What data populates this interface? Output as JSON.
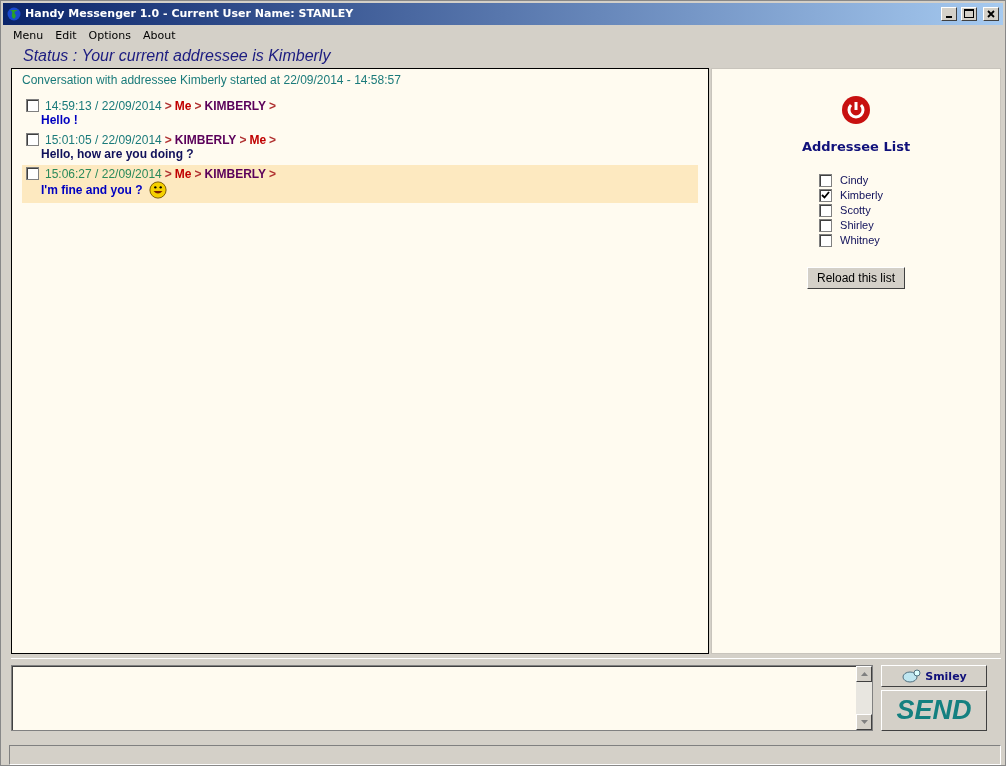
{
  "window": {
    "title": "Handy Messenger 1.0 - Current User Name: STANLEY"
  },
  "menu": [
    "Menu",
    "Edit",
    "Options",
    "About"
  ],
  "status": "Status : Your current addressee is Kimberly",
  "conversation": {
    "header": "Conversation with addressee Kimberly started at 22/09/2014 - 14:58:57",
    "separator": ">",
    "messages": [
      {
        "time": "14:59:13 / 22/09/2014",
        "from": "Me",
        "to": "KIMBERLY",
        "text": "Hello !",
        "kind": "outgoing",
        "checked": false,
        "selected": false,
        "smiley": false
      },
      {
        "time": "15:01:05 / 22/09/2014",
        "from": "KIMBERLY",
        "to": "Me",
        "text": "Hello, how are you doing ?",
        "kind": "incoming",
        "checked": false,
        "selected": false,
        "smiley": false
      },
      {
        "time": "15:06:27 / 22/09/2014",
        "from": "Me",
        "to": "KIMBERLY",
        "text": "I'm fine and you ?",
        "kind": "outgoing",
        "checked": false,
        "selected": true,
        "smiley": true
      }
    ]
  },
  "addressees": {
    "title": "Addressee List",
    "items": [
      {
        "name": "Cindy",
        "checked": false
      },
      {
        "name": "Kimberly",
        "checked": true
      },
      {
        "name": "Scotty",
        "checked": false
      },
      {
        "name": "Shirley",
        "checked": false
      },
      {
        "name": "Whitney",
        "checked": false
      }
    ],
    "reload_button": "Reload this list"
  },
  "composer": {
    "smiley_button": "Smiley",
    "send_button": "SEND"
  }
}
